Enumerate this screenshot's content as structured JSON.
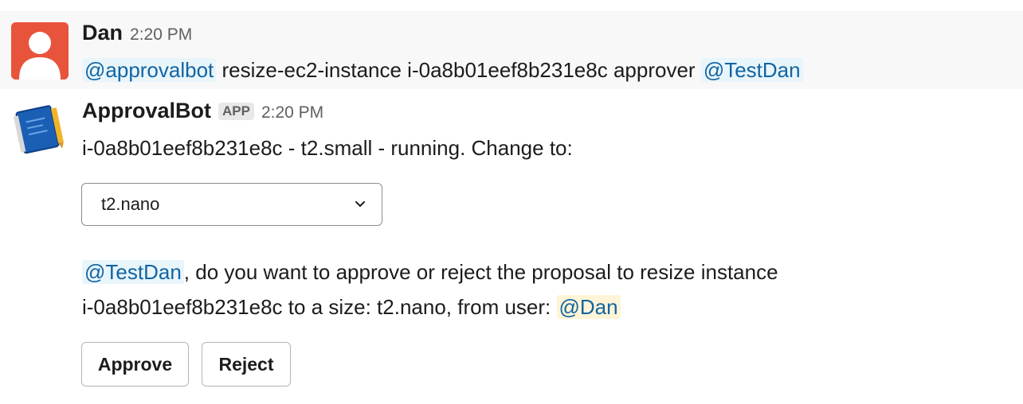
{
  "messages": [
    {
      "sender": "Dan",
      "time": "2:20 PM",
      "mention_bot": "@approvalbot",
      "command": "resize-ec2-instance i-0a8b01eef8b231e8c approver",
      "mention_approver": "@TestDan"
    },
    {
      "sender": "ApprovalBot",
      "badge": "APP",
      "time": "2:20 PM",
      "status_line": "i-0a8b01eef8b231e8c - t2.small - running. Change to:",
      "select_value": "t2.nano",
      "mention_approver": "@TestDan",
      "question_part1": ", do you want to approve or reject the proposal to resize instance",
      "question_part2": "i-0a8b01eef8b231e8c to a size: t2.nano, from user:",
      "mention_user": "@Dan",
      "approve_label": "Approve",
      "reject_label": "Reject"
    }
  ],
  "colors": {
    "mention_text": "#1264a3",
    "mention_bg": "#e8f5fa",
    "self_mention_bg": "#fff5d6",
    "avatar_red": "#e8543b",
    "hover_bg": "#f8f8f8"
  },
  "icons": {
    "user_avatar": "default-user-avatar-icon",
    "bot_avatar": "blueprint-book-icon",
    "select_caret": "chevron-down-icon"
  }
}
